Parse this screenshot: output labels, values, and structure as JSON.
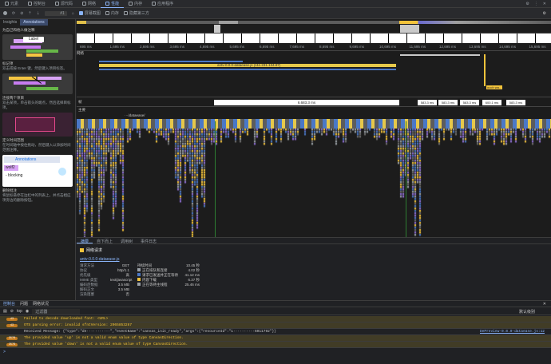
{
  "tabs": [
    {
      "label": "元素",
      "active": false
    },
    {
      "label": "控制台",
      "active": false
    },
    {
      "label": "源代码",
      "active": false
    },
    {
      "label": "网络",
      "active": false
    },
    {
      "label": "性能",
      "active": true
    },
    {
      "label": "内存",
      "active": false
    },
    {
      "label": "应用程序",
      "active": false
    }
  ],
  "toolbar": {
    "recording": "#1",
    "screenshots_label": "屏幕截图",
    "memory_label": "内存",
    "third_party_label": "隐藏第三方"
  },
  "sidebar": {
    "tabs": [
      "Insights",
      "Annotations"
    ],
    "intro": "为自己和他人做注释",
    "card1_label": "Label",
    "card1_title": "标记项",
    "card1_desc": "双击或按 Enter 键，然后键入项目标签。",
    "card2_title": "连接两个项目",
    "card2_desc": "双击某项，单击箭头的端点，然后选择目标项。",
    "card3_title": "定义时间范围",
    "card3_desc": "在时间轴中按住拖动，然后键入以添加时间范围注释。",
    "card4_header": "Annotations",
    "card4_item1": "wolf2",
    "card4_item2": "- blocking",
    "card4_title": "删除批注",
    "card4_desc": "将鼠标悬停在边栏中的列表上，并点击相应项旁边的删除按钮。"
  },
  "ruler_ticks": [
    "695 ms",
    "1,695 ms",
    "2,695 ms",
    "3,695 ms",
    "4,695 ms",
    "5,695 ms",
    "6,695 ms",
    "7,695 ms",
    "8,695 ms",
    "9,695 ms",
    "10,695 ms",
    "11,695 ms",
    "12,695 ms",
    "13,695 ms",
    "14,695 ms",
    "15,695 ms"
  ],
  "overview_ticks": [
    "695 ms",
    "1,695 ms",
    "2,695 ms",
    "3,695 ms",
    "4,695 ms",
    "5,695 ms",
    "6,695 ms",
    "7,695 ms",
    "8,695 ms",
    "9,695 ms",
    "10,695 ms",
    "11,695 ms",
    "12,695 ms",
    "13,695 ms",
    "14,695 ms",
    "15,695 ms",
    "16,695 ms"
  ],
  "tracks": {
    "network_label": "网络",
    "bar_label": "antv-0.0.0-dataease.js (111.231.134.87)",
    "frames_label": "帧",
    "frame_main": "6,683.3 ms",
    "frame_segments": [
      "583.3 ms",
      "583.3 ms",
      "583.3 ms",
      "600.1 ms",
      "583.3 ms"
    ],
    "main_label": "主要",
    "main_url": "···/dataease/",
    "short_marker": "ouch wa..."
  },
  "markers": {
    "fcp": "FCP",
    "lcp": "LCP",
    "nav": "Nav"
  },
  "summary": {
    "tabs": [
      "摘要",
      "自下而上",
      "调用树",
      "事件日志"
    ],
    "title": "网络请求",
    "file": "antv-0.0.0-dataease.js",
    "props": [
      {
        "k": "请求方法",
        "v": "GET"
      },
      {
        "k": "协议",
        "v": "http/1.1"
      },
      {
        "k": "优先级",
        "v": "高"
      },
      {
        "k": "MIME 类型",
        "v": "text/javascript"
      },
      {
        "k": "编码后数据",
        "v": "3.5 MB"
      },
      {
        "k": "解码正文",
        "v": "3.5 MB"
      },
      {
        "k": "渲染阻塞",
        "v": "否"
      }
    ],
    "timing": [
      {
        "k": "持续时间",
        "v": "10.45 秒"
      },
      {
        "k": "正在排队和连接",
        "v": "4.02 秒"
      },
      {
        "k": "请求已发送并正在等待",
        "v": "41.12 ms"
      },
      {
        "k": "内容下载",
        "v": "6.37 秒"
      },
      {
        "k": "正在等待主线程",
        "v": "25.46 ms"
      }
    ]
  },
  "console": {
    "tabs": [
      "控制台",
      "问题",
      "网络状况"
    ],
    "context": "top",
    "filter_placeholder": "过滤器",
    "level": "默认级别",
    "rows": [
      {
        "type": "warn",
        "text": "Failed to decode downloaded font: <URL>",
        "src": ""
      },
      {
        "type": "warn",
        "text": "OTS parsing error: invalid sfntVersion: 2065853267",
        "src": ""
      },
      {
        "type": "info",
        "text": "Received Message: {\"type\":\"de···········\",\"eventName\":\"canvas_init_ready\",\"args\":{\"resourceId\":\"1··········6011792\"}}",
        "src": "DePreview-0.0.0-dataease.js:12"
      },
      {
        "type": "warn",
        "text": "The provided value 'up' is not a valid enum value of type CanvasDirection.",
        "src": ""
      },
      {
        "type": "warn",
        "text": "The provided value 'down' is not a valid enum value of type CanvasDirection.",
        "src": ""
      }
    ],
    "badges": [
      "43",
      "43",
      "",
      "3576",
      "3576"
    ]
  },
  "colors": {
    "accent": "#8ab4f8",
    "script": "#f2c33b",
    "render": "#8e6fd4",
    "net_bar": "#e6c84a",
    "net_blue": "#4a78c7"
  }
}
